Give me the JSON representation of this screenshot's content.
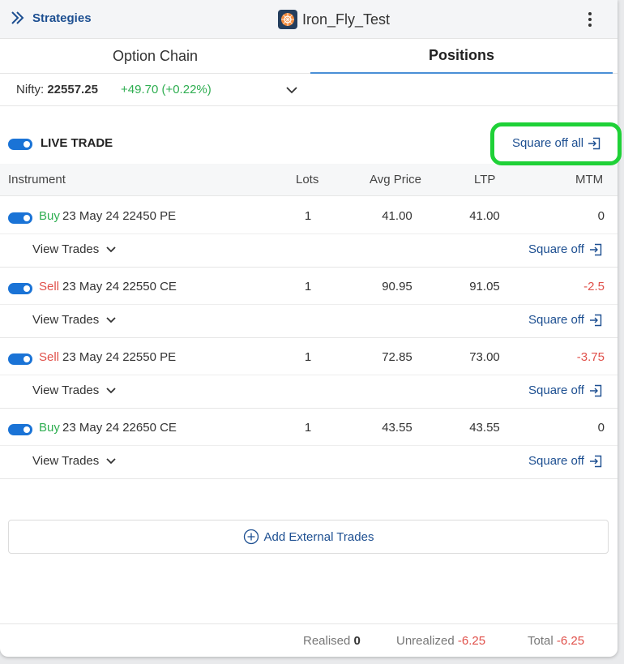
{
  "header": {
    "back_label": "Strategies",
    "title": "Iron_Fly_Test"
  },
  "tabs": [
    {
      "label": "Option Chain",
      "active": false
    },
    {
      "label": "Positions",
      "active": true
    }
  ],
  "index": {
    "name": "Nifty:",
    "value": "22557.25",
    "change": "+49.70 (+0.22%)"
  },
  "live_trade": {
    "label": "LIVE TRADE",
    "enabled": true,
    "square_off_all_label": "Square off all"
  },
  "table": {
    "columns": [
      "Instrument",
      "Lots",
      "Avg Price",
      "LTP",
      "MTM"
    ],
    "rows": [
      {
        "side": "Buy",
        "instrument": "23 May 24 22450 PE",
        "lots": "1",
        "avg_price": "41.00",
        "ltp": "41.00",
        "mtm": "0",
        "view_trades": "View Trades",
        "square_off": "Square off"
      },
      {
        "side": "Sell",
        "instrument": "23 May 24 22550 CE",
        "lots": "1",
        "avg_price": "90.95",
        "ltp": "91.05",
        "mtm": "-2.5",
        "view_trades": "View Trades",
        "square_off": "Square off"
      },
      {
        "side": "Sell",
        "instrument": "23 May 24 22550 PE",
        "lots": "1",
        "avg_price": "72.85",
        "ltp": "73.00",
        "mtm": "-3.75",
        "view_trades": "View Trades",
        "square_off": "Square off"
      },
      {
        "side": "Buy",
        "instrument": "23 May 24 22650 CE",
        "lots": "1",
        "avg_price": "43.55",
        "ltp": "43.55",
        "mtm": "0",
        "view_trades": "View Trades",
        "square_off": "Square off"
      }
    ]
  },
  "add_external_label": "Add External Trades",
  "footer": {
    "realised_label": "Realised",
    "realised_value": "0",
    "unrealized_label": "Unrealized",
    "unrealized_value": "-6.25",
    "total_label": "Total",
    "total_value": "-6.25"
  },
  "colors": {
    "accent": "#1d4f91",
    "positive": "#2fae51",
    "negative": "#e0504a",
    "toggle": "#1a73d6",
    "highlight": "#1fd137"
  }
}
